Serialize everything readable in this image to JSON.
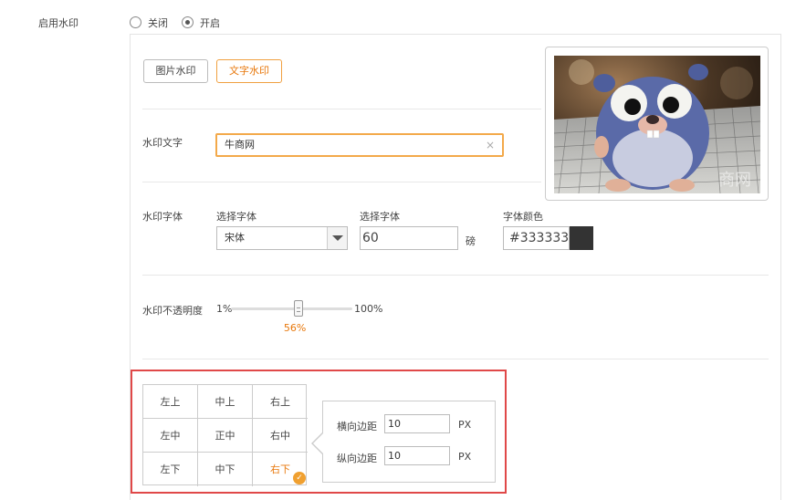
{
  "enable": {
    "label": "启用水印",
    "options": [
      {
        "label": "关闭",
        "selected": false
      },
      {
        "label": "开启",
        "selected": true
      }
    ]
  },
  "tabs": [
    {
      "label": "图片水印",
      "active": false
    },
    {
      "label": "文字水印",
      "active": true
    }
  ],
  "watermark_text": {
    "label": "水印文字",
    "value": "牛商网",
    "clear_icon": "×"
  },
  "font": {
    "label": "水印字体",
    "family_label": "选择字体",
    "family_value": "宋体",
    "size_label": "选择字体",
    "size_value": "60",
    "size_unit": "磅",
    "color_label": "字体颜色",
    "color_value": "#333333",
    "swatch_color": "#333333"
  },
  "opacity": {
    "label": "水印不透明度",
    "min_label": "1%",
    "max_label": "100%",
    "value_label": "56%",
    "value": 56
  },
  "preview": {
    "watermark_text": "商网"
  },
  "position": {
    "cells": [
      "左上",
      "中上",
      "右上",
      "左中",
      "正中",
      "右中",
      "左下",
      "中下",
      "右下"
    ],
    "selected_index": 8,
    "check_icon": "✓",
    "accent_color": "#e8780c",
    "highlight_color": "#e04848"
  },
  "margins": {
    "horizontal_label": "横向边距",
    "horizontal_value": "10",
    "horizontal_unit": "PX",
    "vertical_label": "纵向边距",
    "vertical_value": "10",
    "vertical_unit": "PX"
  }
}
